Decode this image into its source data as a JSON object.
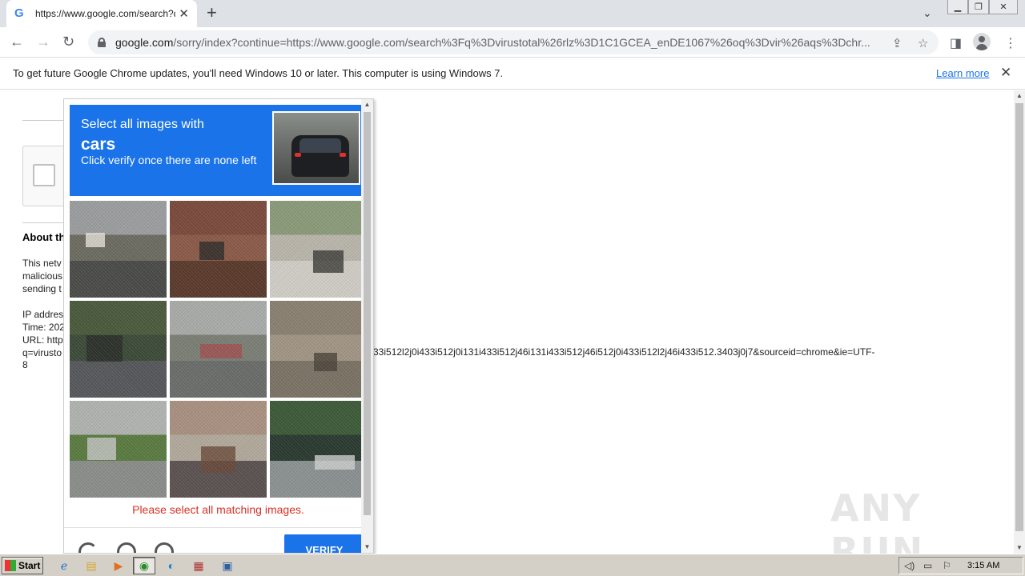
{
  "browser": {
    "tab_title": "https://www.google.com/search?q=",
    "tab_favicon": "G",
    "url_host": "google.com",
    "url_rest": "/sorry/index?continue=https://www.google.com/search%3Fq%3Dvirustotal%26rlz%3D1C1GCEA_enDE1067%26oq%3Dvir%26aqs%3Dchr...",
    "new_tab_label": "+"
  },
  "infobar": {
    "message": "To get future Google Chrome updates, you'll need Windows 10 or later. This computer is using Windows 7.",
    "learn_more": "Learn more"
  },
  "page": {
    "about_heading": "About th",
    "paragraph_lines": [
      "This netv",
      "malicious",
      "sending t"
    ],
    "info_lines": [
      "IP addres",
      "Time: 202",
      "URL: http",
      "q=virusto"
    ],
    "url_tail": "33i512l2j0i433i512j0i131i433i512j46i131i433i512j46i512j0i433i512l2j46i433i512.3403j0j7&sourceid=chrome&ie=UTF-",
    "url_eight": "8"
  },
  "captcha": {
    "instruction_line1": "Select all images with",
    "target_word": "cars",
    "instruction_line2": "Click verify once there are none left",
    "error": "Please select all matching images.",
    "verify_label": "VERIFY",
    "tiles": [
      {
        "name": "house-street",
        "sky": "#9a9c9e",
        "mid": "#6b6b60",
        "ground": "#4a4a48",
        "accent": "#e8e4dc"
      },
      {
        "name": "traffic-light-brick",
        "sky": "#7a4a3c",
        "mid": "#8a5a48",
        "ground": "#5a3a2c",
        "accent": "#2a2a2a"
      },
      {
        "name": "fence-road",
        "sky": "#8a9a78",
        "mid": "#b8b4aa",
        "ground": "#cfcbc4",
        "accent": "#3a3a34"
      },
      {
        "name": "road-trees",
        "sky": "#4a5a3c",
        "mid": "#3c4a38",
        "ground": "#55575a",
        "accent": "#2a2c2a"
      },
      {
        "name": "open-road",
        "sky": "#a8aaa8",
        "mid": "#7a7e74",
        "ground": "#6a6c6a",
        "accent": "#a05050"
      },
      {
        "name": "stairs",
        "sky": "#8a8070",
        "mid": "#a09484",
        "ground": "#7a7264",
        "accent": "#4a4238"
      },
      {
        "name": "parked-car-street",
        "sky": "#b0b2b0",
        "mid": "#5a7a40",
        "ground": "#8a8c8a",
        "accent": "#c8c8c8"
      },
      {
        "name": "sidewalk",
        "sky": "#a89080",
        "mid": "#b0a89a",
        "ground": "#5a5250",
        "accent": "#6a4a3a"
      },
      {
        "name": "tree-shade",
        "sky": "#3c5a38",
        "mid": "#2a3a30",
        "ground": "#8a9090",
        "accent": "#d0d0d0"
      }
    ]
  },
  "watermark": "ANY RUN",
  "taskbar": {
    "start_label": "Start",
    "clock": "3:15 AM"
  },
  "colors": {
    "captcha_blue": "#1a73e8",
    "error_red": "#d93025",
    "link_blue": "#1a73e8"
  }
}
